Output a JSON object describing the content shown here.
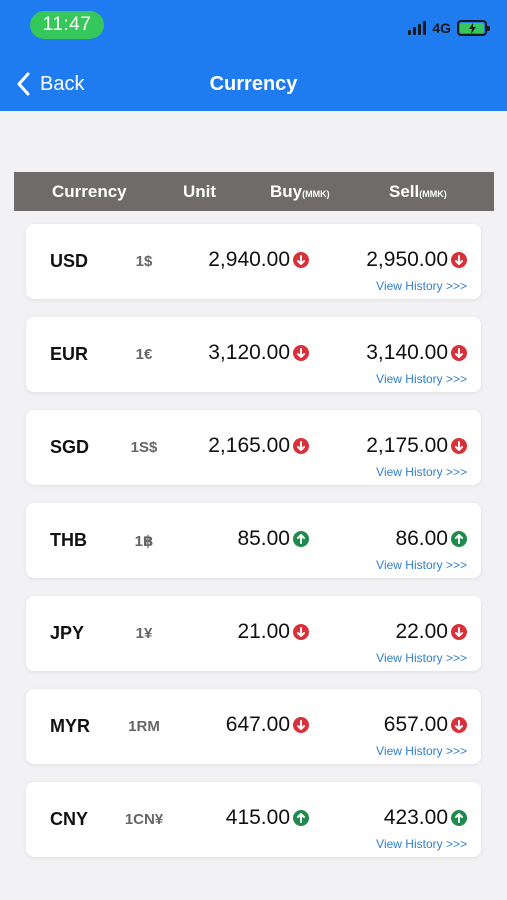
{
  "status_bar": {
    "time": "11:47",
    "network": "4G"
  },
  "nav": {
    "back_label": "Back",
    "title": "Currency"
  },
  "table_header": {
    "currency": "Currency",
    "unit": "Unit",
    "buy": "Buy",
    "buy_unit": "(MMK)",
    "sell": "Sell",
    "sell_unit": "(MMK)"
  },
  "history_label": "View History >>>",
  "colors": {
    "accent": "#1e7cf0",
    "down": "#d9303a",
    "up": "#1f8a4c",
    "history_link": "#2f7fd0"
  },
  "rows": [
    {
      "code": "USD",
      "unit": "1$",
      "buy": "2,940.00",
      "buy_trend": "down",
      "sell": "2,950.00",
      "sell_trend": "down"
    },
    {
      "code": "EUR",
      "unit": "1€",
      "buy": "3,120.00",
      "buy_trend": "down",
      "sell": "3,140.00",
      "sell_trend": "down"
    },
    {
      "code": "SGD",
      "unit": "1S$",
      "buy": "2,165.00",
      "buy_trend": "down",
      "sell": "2,175.00",
      "sell_trend": "down"
    },
    {
      "code": "THB",
      "unit": "1฿",
      "buy": "85.00",
      "buy_trend": "up",
      "sell": "86.00",
      "sell_trend": "up"
    },
    {
      "code": "JPY",
      "unit": "1¥",
      "buy": "21.00",
      "buy_trend": "down",
      "sell": "22.00",
      "sell_trend": "down"
    },
    {
      "code": "MYR",
      "unit": "1RM",
      "buy": "647.00",
      "buy_trend": "down",
      "sell": "657.00",
      "sell_trend": "down"
    },
    {
      "code": "CNY",
      "unit": "1CN¥",
      "buy": "415.00",
      "buy_trend": "up",
      "sell": "423.00",
      "sell_trend": "up"
    }
  ]
}
